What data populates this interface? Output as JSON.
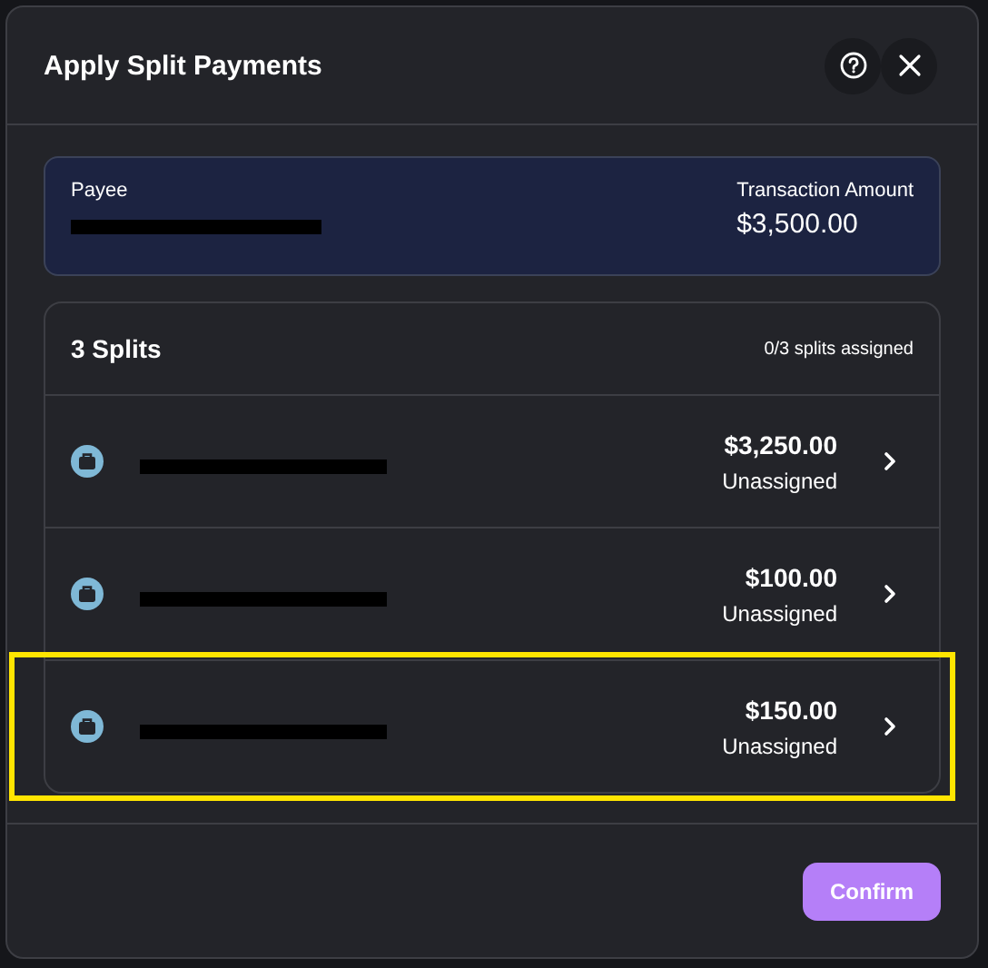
{
  "dialog": {
    "title": "Apply Split Payments"
  },
  "payee": {
    "label": "Payee",
    "redacted": true,
    "amount_label": "Transaction Amount",
    "amount": "$3,500.00"
  },
  "splits": {
    "title": "3 Splits",
    "status": "0/3 splits assigned",
    "items": [
      {
        "redacted": true,
        "amount": "$3,250.00",
        "status": "Unassigned",
        "highlighted": false
      },
      {
        "redacted": true,
        "amount": "$100.00",
        "status": "Unassigned",
        "highlighted": false
      },
      {
        "redacted": true,
        "amount": "$150.00",
        "status": "Unassigned",
        "highlighted": true
      }
    ]
  },
  "buttons": [
    "Confirm"
  ]
}
